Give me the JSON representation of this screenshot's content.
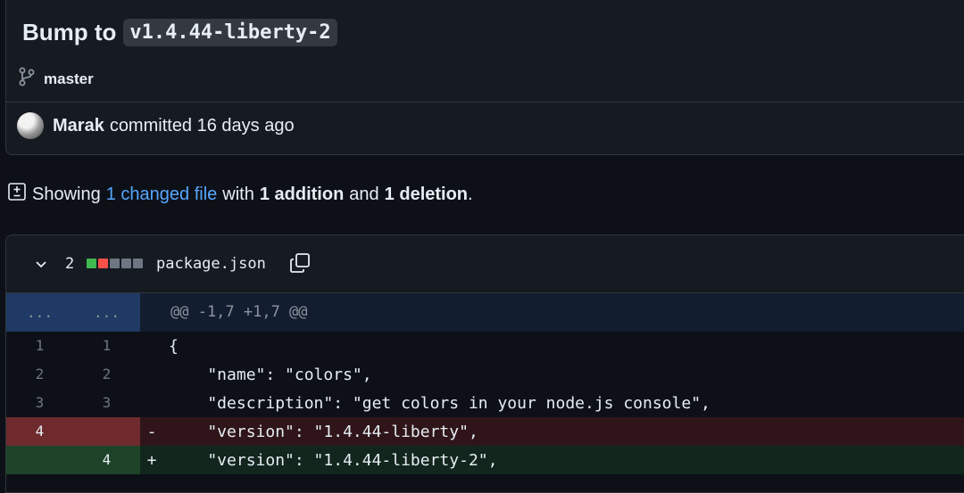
{
  "commit": {
    "title": "Bump to",
    "title_code": "v1.4.44-liberty-2",
    "branch": "master",
    "author": "Marak",
    "action": "committed 16 days ago"
  },
  "summary": {
    "prefix": "Showing",
    "changed_link": "1 changed file",
    "with": "with",
    "additions": "1 addition",
    "and": "and",
    "deletions": "1 deletion",
    "suffix": "."
  },
  "file": {
    "count": "2",
    "name": "package.json",
    "stat_colors": [
      "#3fb950",
      "#f85149",
      "#6e7681",
      "#6e7681",
      "#6e7681"
    ]
  },
  "hunk": {
    "left": "...",
    "right": "...",
    "header": "@@ -1,7 +1,7 @@"
  },
  "lines": [
    {
      "old": "1",
      "new": "1",
      "sign": "",
      "text": "{"
    },
    {
      "old": "2",
      "new": "2",
      "sign": "",
      "text": "    \"name\": \"colors\","
    },
    {
      "old": "3",
      "new": "3",
      "sign": "",
      "text": "    \"description\": \"get colors in your node.js console\","
    },
    {
      "old": "4",
      "new": "",
      "sign": "-",
      "text": "    \"version\": \"1.4.44-liberty\","
    },
    {
      "old": "",
      "new": "4",
      "sign": "+",
      "text": "    \"version\": \"1.4.44-liberty-2\","
    }
  ]
}
